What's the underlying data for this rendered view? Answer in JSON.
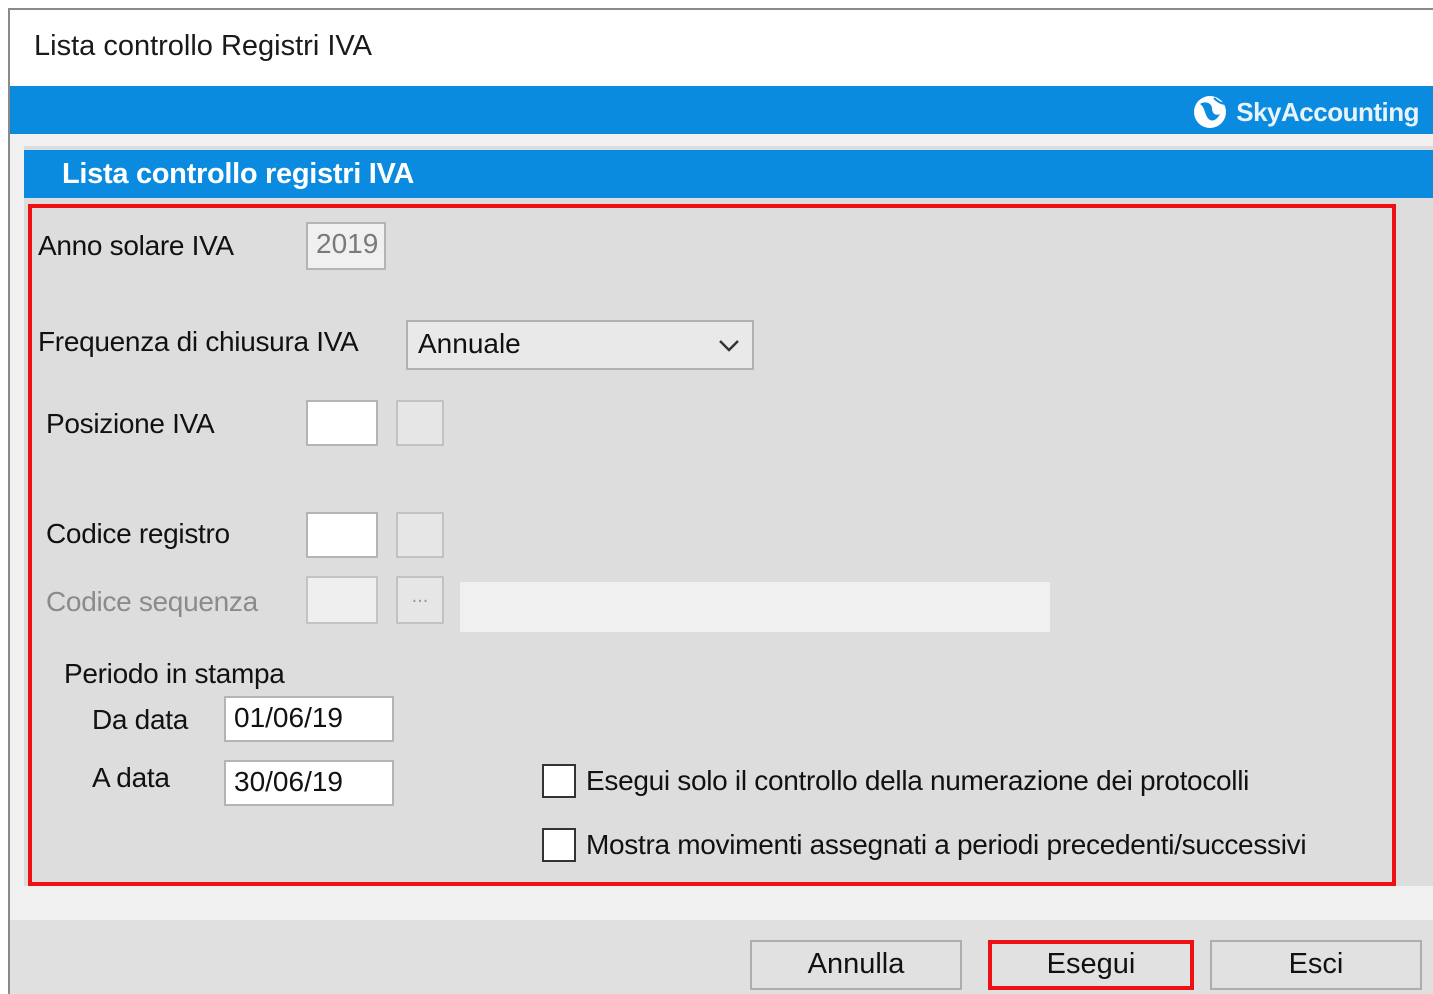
{
  "window": {
    "title": "Lista controllo Registri IVA"
  },
  "brand": {
    "name": "SkyAccounting",
    "color": "#0a8be0"
  },
  "panel": {
    "header": "Lista controllo registri IVA"
  },
  "form": {
    "anno_label": "Anno solare IVA",
    "anno_value": "2019",
    "frequenza_label": "Frequenza di chiusura IVA",
    "frequenza_value": "Annuale",
    "posizione_label": "Posizione IVA",
    "codice_registro_label": "Codice registro",
    "codice_sequenza_label": "Codice sequenza",
    "ellipsis": "...",
    "periodo_label": "Periodo in stampa",
    "da_data_label": "Da data",
    "da_data_value": "01/06/19",
    "a_data_label": "A data",
    "a_data_value": "30/06/19",
    "check_protocolli": "Esegui solo il controllo della numerazione dei protocolli",
    "check_movimenti": "Mostra movimenti assegnati a periodi precedenti/successivi"
  },
  "buttons": {
    "annulla": "Annulla",
    "esegui": "Esegui",
    "esci": "Esci"
  },
  "highlight_color": "#ee1111"
}
